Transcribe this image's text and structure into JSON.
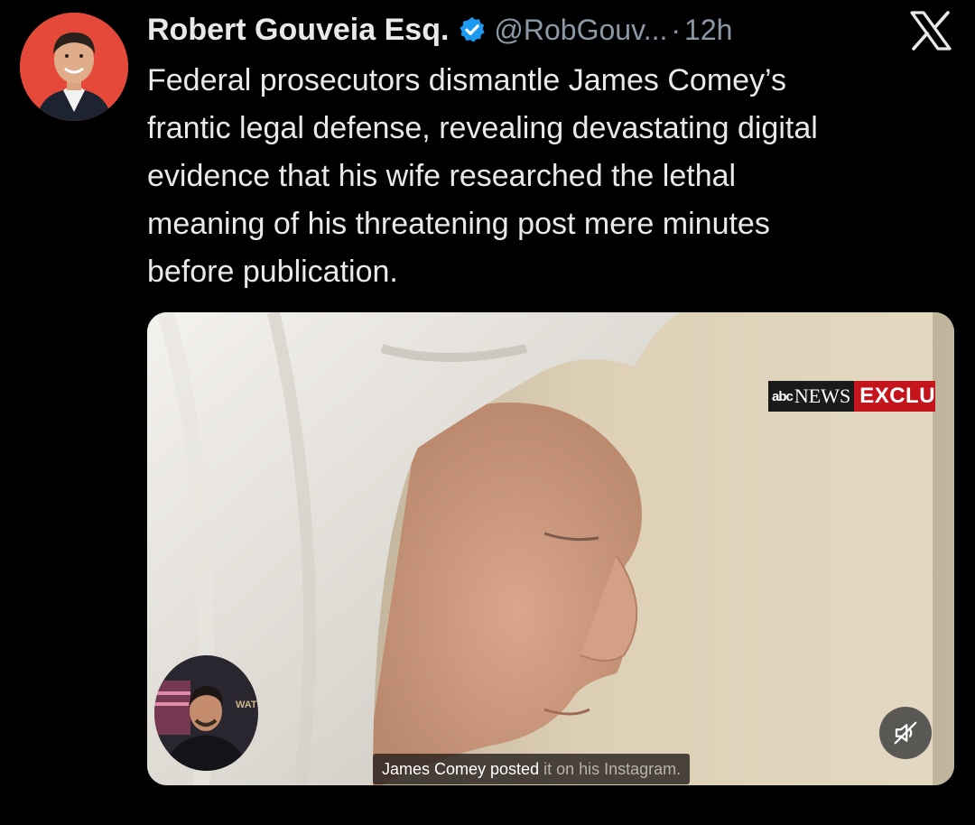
{
  "tweet": {
    "author": {
      "display_name": "Robert Gouveia Esq.",
      "handle": "@RobGouv...",
      "verified": true,
      "avatar_icon": "avatar-photo"
    },
    "separator": "·",
    "timestamp": "12h",
    "platform_icon": "x-logo-icon",
    "text": "Federal prosecutors dismantle James Comey’s\nfrantic legal defense, revealing devastating digital\nevidence that his wife researched the lethal\nmeaning of his threatening post mere minutes\nbefore publication."
  },
  "media": {
    "type": "video",
    "news_badge": {
      "logo_text": "abc",
      "network": "NEWS",
      "label": "EXCLU"
    },
    "pip_label": "WATC",
    "caption": {
      "highlighted": "James Comey posted",
      "remaining": "it on his Instagram."
    },
    "mute_icon": "speaker-muted-icon"
  },
  "colors": {
    "background": "#000000",
    "text_primary": "#e7e9ea",
    "text_secondary": "#8b98a5",
    "verified_blue": "#1d9bf0",
    "avatar_bg": "#e5493a",
    "badge_red": "#c4141c"
  }
}
